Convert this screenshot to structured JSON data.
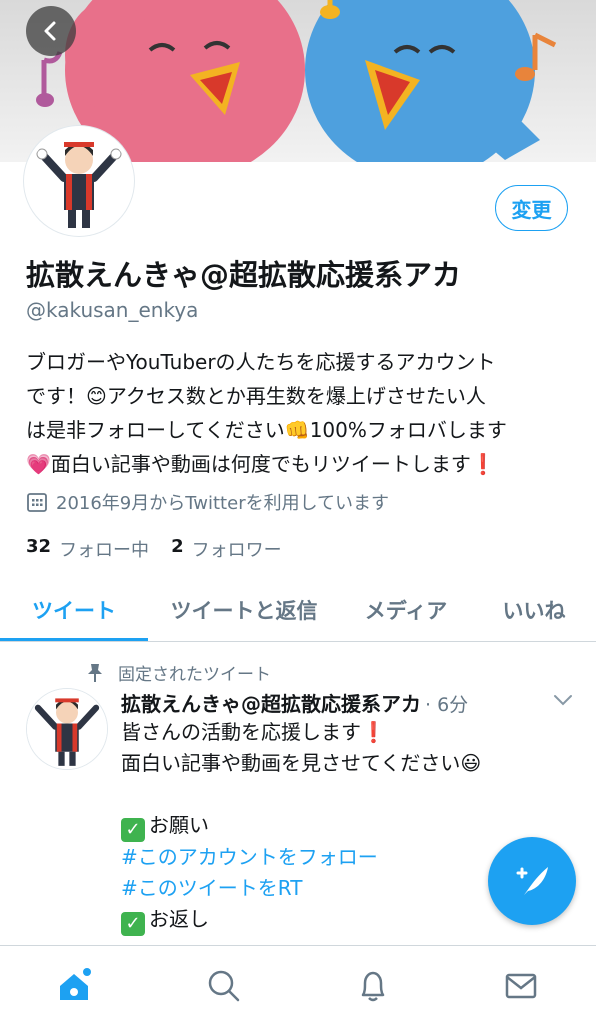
{
  "profile": {
    "display_name": "拡散えんきゃ@超拡散応援系アカ",
    "handle": "@kakusan_enkya",
    "edit_label": "変更",
    "bio_lines": [
      "ブロガーやYouTuberの人たちを応援するアカウント",
      "です！😊アクセス数とか再生数を爆上げさせたい人",
      "は是非フォローしてください👊100%フォロバします",
      "💗面白い記事や動画は何度でもリツイートします❗"
    ],
    "joined": "2016年9月からTwitterを利用しています",
    "following_count": "32",
    "following_label": "フォロー中",
    "followers_count": "2",
    "followers_label": "フォロワー"
  },
  "tabs": [
    "ツイート",
    "ツイートと返信",
    "メディア",
    "いいね"
  ],
  "tweet": {
    "pinned_label": "固定されたツイート",
    "name": "拡散えんきゃ@超拡散応援系アカ",
    "time": "· 6分",
    "line1": "皆さんの活動を応援します❗",
    "line2": "面白い記事や動画を見させてください😃",
    "line3": "",
    "line4": "お願い",
    "line5": "#このアカウントをフォロー",
    "line6": "#このツイートをRT",
    "line7": "お返し"
  },
  "colors": {
    "accent": "#1da1f2",
    "muted": "#657786",
    "text": "#14171a"
  },
  "icons": {
    "back": "chevron-left-icon",
    "calendar": "calendar-icon",
    "pin": "pin-icon",
    "compose": "compose-icon",
    "home": "home-icon",
    "search": "search-icon",
    "bell": "bell-icon",
    "mail": "mail-icon",
    "chevron": "chevron-down-icon"
  }
}
